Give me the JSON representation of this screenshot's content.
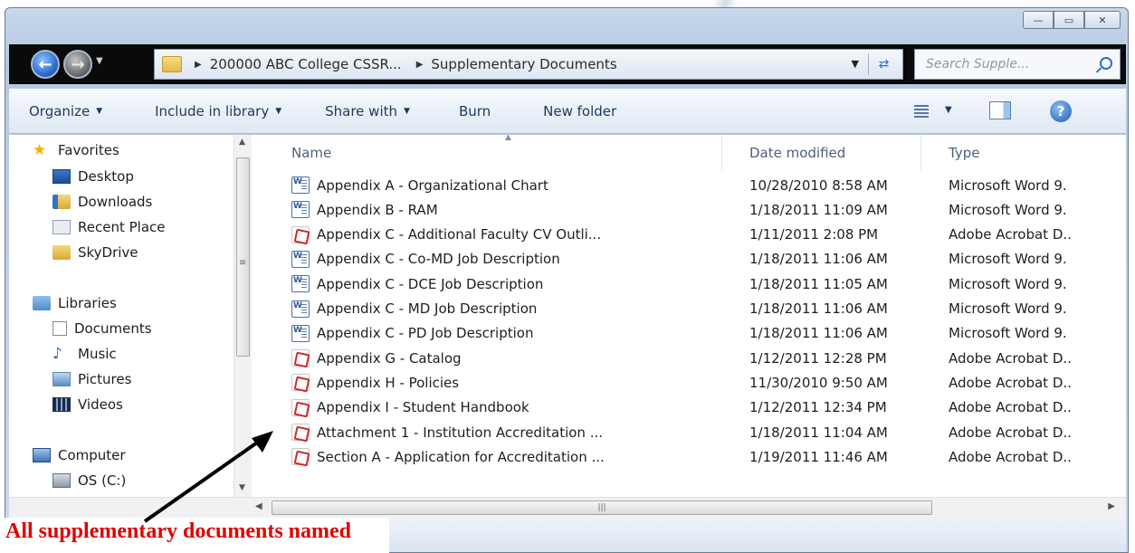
{
  "window": {
    "caption_buttons": {
      "minimize": "—",
      "maximize": "▭",
      "close": "✕"
    }
  },
  "address_bar": {
    "breadcrumbs": [
      "200000 ABC College CSSR...",
      "Supplementary Documents"
    ],
    "search_placeholder": "Search Supple..."
  },
  "toolbar": {
    "organize": "Organize",
    "include_in_library": "Include in library",
    "share_with": "Share with",
    "burn": "Burn",
    "new_folder": "New folder"
  },
  "nav_pane": {
    "favorites": "Favorites",
    "desktop": "Desktop",
    "downloads": "Downloads",
    "recent_places": "Recent Placе",
    "skydrive": "SkyDrive",
    "libraries": "Libraries",
    "documents": "Documents",
    "music": "Music",
    "pictures": "Pictures",
    "videos": "Videos",
    "computer": "Computer",
    "os_drive": "OS (C:)"
  },
  "file_list": {
    "columns": {
      "name": "Name",
      "date": "Date modified",
      "type": "Type"
    },
    "files": [
      {
        "icon": "word",
        "name": "Appendix A - Organizational Chart",
        "date": "10/28/2010 8:58 AM",
        "type": "Microsoft Word 9."
      },
      {
        "icon": "word",
        "name": "Appendix B - RAM",
        "date": "1/18/2011 11:09 AM",
        "type": "Microsoft Word 9."
      },
      {
        "icon": "pdf",
        "name": "Appendix C - Additional Faculty CV Outli...",
        "date": "1/11/2011 2:08 PM",
        "type": "Adobe Acrobat D.."
      },
      {
        "icon": "word",
        "name": "Appendix C - Co-MD Job Description",
        "date": "1/18/2011 11:06 AM",
        "type": "Microsoft Word 9."
      },
      {
        "icon": "word",
        "name": "Appendix C - DCE Job Description",
        "date": "1/18/2011 11:05 AM",
        "type": "Microsoft Word 9."
      },
      {
        "icon": "word",
        "name": "Appendix C - MD Job Description",
        "date": "1/18/2011 11:06 AM",
        "type": "Microsoft Word 9."
      },
      {
        "icon": "word",
        "name": "Appendix C - PD Job Description",
        "date": "1/18/2011 11:06 AM",
        "type": "Microsoft Word 9."
      },
      {
        "icon": "pdf",
        "name": "Appendix G - Catalog",
        "date": "1/12/2011 12:28 PM",
        "type": "Adobe Acrobat D.."
      },
      {
        "icon": "pdf",
        "name": "Appendix H - Policies",
        "date": "11/30/2010 9:50 AM",
        "type": "Adobe Acrobat D.."
      },
      {
        "icon": "pdf",
        "name": "Appendix I - Student Handbook",
        "date": "1/12/2011 12:34 PM",
        "type": "Adobe Acrobat D.."
      },
      {
        "icon": "pdf",
        "name": "Attachment 1 - Institution Accreditation ...",
        "date": "1/18/2011 11:04 AM",
        "type": "Adobe Acrobat D.."
      },
      {
        "icon": "pdf",
        "name": "Section A - Application for Accreditation ...",
        "date": "1/19/2011 11:46 AM",
        "type": "Adobe Acrobat D.."
      }
    ]
  },
  "annotation": {
    "text": "All supplementary documents named",
    "color": "#e00000"
  },
  "colors": {
    "annotation_red": "#e00000",
    "accent_blue": "#2e6ecd"
  }
}
